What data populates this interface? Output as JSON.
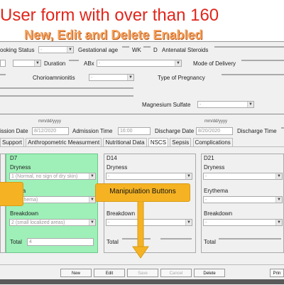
{
  "banner": {
    "title": "User form with over than 160",
    "subtitle": "New, Edit and Delete Enabled"
  },
  "row1": {
    "booking_status_label": "ooking Status",
    "booking_status_value": "-",
    "gestational_age_label": "Gestational age",
    "wk_label": "WK",
    "d_label": "D",
    "antenatal_steroids_label": "Antenatal Steroids"
  },
  "row2": {
    "duration_label": "Duration",
    "abx_label": "ABx",
    "abx_value": "-",
    "mode_of_delivery_label": "Mode of Delivery"
  },
  "row3": {
    "chorioamnionitis_label": "Chorioamnionitis",
    "chorioamnionitis_value": "-",
    "type_of_pregnancy_label": "Type of Pregnancy"
  },
  "row4": {
    "magnesium_sulfate_label": "Magnesium Sulfate",
    "magnesium_sulfate_value": "-"
  },
  "admission": {
    "date_format_1": "mm/dd/yyyy",
    "date_format_2": "mm/dd/yyyy",
    "admission_date_label": "ission Date",
    "admission_date_value": "8/12/2020",
    "admission_time_label": "Admission Time",
    "admission_time_value": "16:00",
    "discharge_date_label": "Discharge Date",
    "discharge_date_value": "8/20/2020",
    "discharge_time_label": "Discharge Time"
  },
  "tabs": [
    "Support",
    "Anthropometric Measurment",
    "Nutritional Data",
    "NSCS",
    "Sepsis",
    "Complications"
  ],
  "active_tab": "NSCS",
  "panels": {
    "d7": {
      "title": "D7",
      "dryness_label": "Dryness",
      "dryness_value": "1 (Normal, no sign of dry skin)",
      "erythema_label": "thema",
      "erythema_value": "o erythema)",
      "breakdown_label": "Breakdown",
      "breakdown_value": "2 (small localized areas)",
      "total_label": "Total",
      "total_value": "4"
    },
    "d14": {
      "title": "D14",
      "dryness_label": "Dryness",
      "dryness_value": "-",
      "breakdown_label": "Breakdown",
      "breakdown_value": "-",
      "total_label": "Total"
    },
    "d21": {
      "title": "D21",
      "dryness_label": "Dryness",
      "dryness_value": "-",
      "erythema_label": "Erythema",
      "erythema_value": "-",
      "breakdown_label": "Breakdown",
      "breakdown_value": "-",
      "total_label": "Total"
    }
  },
  "callout": {
    "label": "Manipulation Buttons"
  },
  "buttons": {
    "new": "New",
    "edit": "Edit",
    "save": "Save",
    "cancel": "Cancel",
    "delete": "Delete",
    "print": "Prin"
  },
  "colors": {
    "title_red": "#e0261c",
    "subtitle_orange": "#f5a25d",
    "panel_green": "#9ef0b8",
    "callout_orange": "#f5b324"
  }
}
